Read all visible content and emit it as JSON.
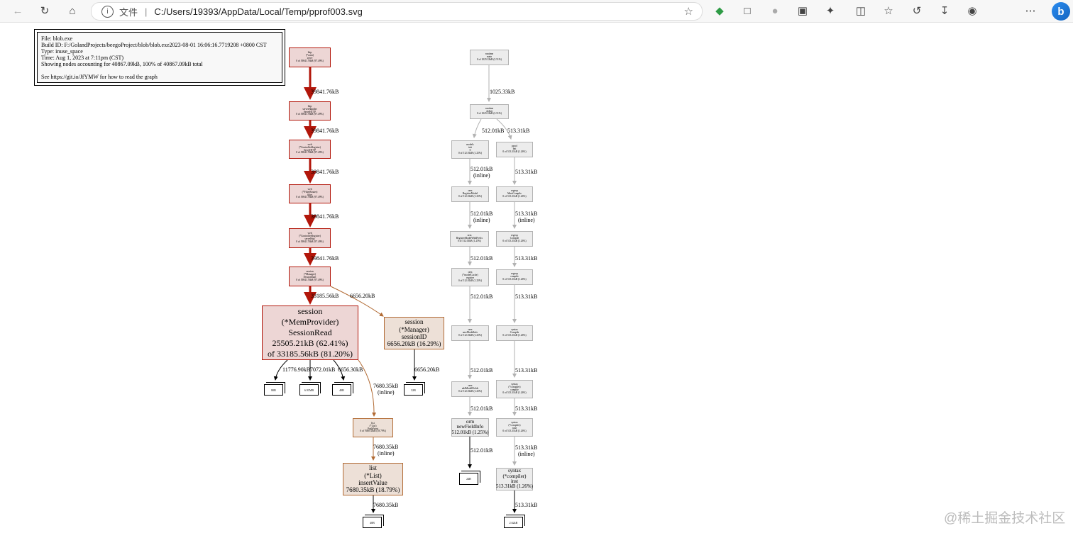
{
  "browser": {
    "address_prefix": "文件",
    "address_url": "C:/Users/19393/AppData/Local/Temp/pprof003.svg"
  },
  "legend": {
    "lines": [
      "File: blob.exe",
      "Build ID: F:/GolandProjects/beegoProject/blob/blob.exe2023-08-01 16:06:16.7719208 +0800 CST",
      "Type: inuse_space",
      "Time: Aug 1, 2023 at 7:11pm (CST)",
      "Showing nodes accounting for 40867.09kB, 100% of 40867.09kB total",
      "",
      "See https://git.io/JfYMW for how to read the graph"
    ]
  },
  "nodes": {
    "http_conn": [
      "http",
      "(*conn)",
      "serve",
      "0 of 39841.76kB (97.49%)"
    ],
    "http_serverhandler": [
      "http",
      "serverHandler",
      "ServeHTTP",
      "0 of 39841.76kB (97.49%)"
    ],
    "web_controller_serve": [
      "web",
      "(*ControllerRegister)",
      "ServeHTTP",
      "0 of 39841.76kB (97.49%)"
    ],
    "web_filterrouter": [
      "web",
      "(*FilterRouter)",
      "filter",
      "0 of 39841.76kB (97.49%)"
    ],
    "web_controller_servehttp": [
      "web",
      "(*ControllerRegister)",
      "serveHttp",
      "0 of 39841.76kB (97.49%)"
    ],
    "session_manager_start": [
      "session",
      "(*Manager)",
      "SessionStart",
      "0 of 39841.76kB (97.49%)"
    ],
    "session_memprovider": [
      "session",
      "(*MemProvider)",
      "SessionRead",
      "25505.21kB (62.41%)",
      "of 33185.56kB (81.20%)"
    ],
    "session_manager_id": [
      "session",
      "(*Manager)",
      "sessionID",
      "6656.20kB (16.29%)"
    ],
    "list_pushfront": [
      "list",
      "(*List)",
      "PushFront",
      "0 of 7680.35kB (18.79%)"
    ],
    "list_insertvalue": [
      "list",
      "(*List)",
      "insertValue",
      "7680.35kB (18.79%)"
    ],
    "runtime_main": [
      "runtime",
      "main",
      "0 of 1025.33kB (2.51%)"
    ],
    "runtime_doinit": [
      "runtime",
      "doInit",
      "0 of 1025.33kB (2.51%)"
    ],
    "models_init": [
      "models",
      "init",
      "0",
      "0 of 512.01kB (1.25%)"
    ],
    "pprof_init": [
      "pprof",
      "init",
      "0 of 513.31kB (1.26%)"
    ],
    "orm_registermodel": [
      "orm",
      "RegisterModel",
      "0 of 512.01kB (1.25%)"
    ],
    "regexp_mustcompile": [
      "regexp",
      "MustCompile",
      "0 of 513.31kB (1.26%)"
    ],
    "orm_registermodelwithprefix": [
      "orm",
      "RegisterModelWithPrefix",
      "0 of 512.01kB (1.25%)"
    ],
    "regexp_compile_upper": [
      "regexp",
      "Compile",
      "0 of 513.31kB (1.26%)"
    ],
    "orm_modelcache_register": [
      "orm",
      "(*modelCache)",
      "register",
      "0 of 512.01kB (1.25%)"
    ],
    "regexp_compile_lower": [
      "regexp",
      "compile",
      "0 of 513.31kB (1.26%)"
    ],
    "orm_newmodelinfo": [
      "orm",
      "newModelInfo",
      "0 of 512.01kB (1.25%)"
    ],
    "syntax_compile": [
      "syntax",
      "Compile",
      "0 of 513.31kB (1.26%)"
    ],
    "orm_addmodelfields": [
      "orm",
      "addModelFields",
      "0 of 512.01kB (1.25%)"
    ],
    "syntax_compiler_compile": [
      "syntax",
      "(*compiler)",
      "compile",
      "0 of 513.31kB (1.26%)"
    ],
    "orm_newfieldinfo": [
      "orm",
      "newFieldInfo",
      "512.01kB (1.25%)"
    ],
    "syntax_compiler_rune": [
      "syntax",
      "(*compiler)",
      "rune",
      "0 of 513.31kB (1.26%)"
    ],
    "syntax_compiler_inst": [
      "syntax",
      "(*compiler)",
      "inst",
      "513.31kB (1.26%)"
    ]
  },
  "boxes": {
    "b1": "80B",
    "b2": "6.91MB",
    "b3": "40B",
    "b4": "32B",
    "b5": "40B",
    "b6": "24B",
    "b7": "2.62kB"
  },
  "edges": {
    "e1": "39841.76kB",
    "e2": "39841.76kB",
    "e3": "39841.76kB",
    "e4": "39841.76kB",
    "e5": "39841.76kB",
    "e6": "33185.56kB",
    "e7": "6656.20kB",
    "e8": "11776.90kB",
    "e9": "7072.01kB",
    "e10": "6656.30kB",
    "e11": "7680.35kB",
    "e11b": "(inline)",
    "e12": "6656.20kB",
    "e13": "7680.35kB",
    "e13b": "(inline)",
    "e14": "7680.35kB",
    "r1": "1025.33kB",
    "r2": "512.01kB",
    "r3": "513.31kB",
    "r4": "512.01kB",
    "r4b": "(inline)",
    "r5": "513.31kB",
    "r6": "512.01kB",
    "r6b": "(inline)",
    "r7": "513.31kB",
    "r7b": "(inline)",
    "r8": "512.01kB",
    "r9": "513.31kB",
    "r10": "512.01kB",
    "r11": "513.31kB",
    "r12": "512.01kB",
    "r13": "513.31kB",
    "r14": "512.01kB",
    "r15": "513.31kB",
    "r16": "512.01kB",
    "r17": "513.31kB",
    "r17b": "(inline)",
    "r18": "513.31kB"
  },
  "watermark": "@稀土掘金技术社区",
  "colors": {
    "hot_edge": "#b2160a",
    "warm_edge": "#b26b34",
    "grey_edge": "#b2b2b2"
  }
}
